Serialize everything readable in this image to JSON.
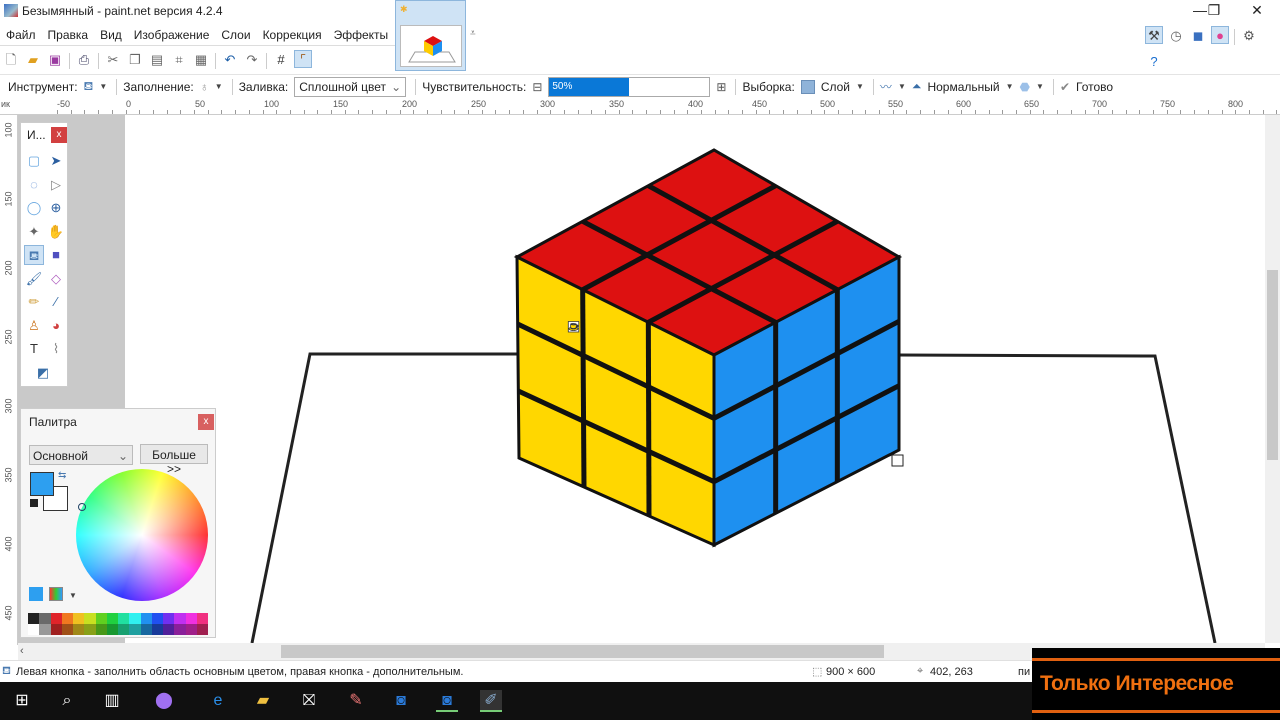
{
  "window": {
    "title": "Безымянный - paint.net версия 4.2.4",
    "minimize": "—",
    "restore": "❐",
    "close": "✕"
  },
  "menu": [
    "Файл",
    "Правка",
    "Вид",
    "Изображение",
    "Слои",
    "Коррекция",
    "Эффекты"
  ],
  "toolbar2": {
    "tool_label": "Инструмент:",
    "fill_mode_label": "Заполнение:",
    "fill_label": "Заливка:",
    "fill_value": "Сплошной цвет",
    "sensitivity_label": "Чувствительность:",
    "sensitivity_value": "50%",
    "sensitivity_percent": 50,
    "sampling_label": "Выборка:",
    "sampling_value": "Слой",
    "blend_value": "Нормальный",
    "done_label": "Готово"
  },
  "ruler_h": [
    "ик",
    "-50",
    "0",
    "50",
    "100",
    "150",
    "200",
    "250",
    "300",
    "350",
    "400",
    "450",
    "500",
    "550",
    "600",
    "650",
    "700",
    "750",
    "800"
  ],
  "ruler_v": [
    "100",
    "150",
    "200",
    "250",
    "300",
    "350",
    "400",
    "450"
  ],
  "tools_window": {
    "title": "И...",
    "close": "x"
  },
  "palette": {
    "title": "Палитра",
    "close": "x",
    "mode": "Основной",
    "more": "Больше >>",
    "primary": "#2d9ff0",
    "secondary": "#ffffff",
    "swatches_top": [
      "#222222",
      "#6a6a6a",
      "#e0242a",
      "#f07820",
      "#f0c020",
      "#c8e020",
      "#60d020",
      "#20d040",
      "#20e0a0",
      "#30f0f0",
      "#2090f0",
      "#2050f0",
      "#7030f0",
      "#c030f0",
      "#f030e0",
      "#f03080"
    ],
    "swatches_bottom": [
      "#ffffff",
      "#999999",
      "#a02020",
      "#a05018",
      "#a08818",
      "#88a018",
      "#489818",
      "#189830",
      "#18a070",
      "#20a0a0",
      "#1868a0",
      "#183a9a",
      "#50209a",
      "#8a209a",
      "#a0208a",
      "#a02050"
    ]
  },
  "cube": {
    "top_color": "#dd1111",
    "left_color": "#ffd700",
    "right_color": "#1e90f0",
    "line_color": "#111111"
  },
  "status": {
    "hint": "Левая кнопка - заполнить область основным цветом, правая кнопка - дополнительным.",
    "image_size": "900 × 600",
    "cursor_pos": "402, 263",
    "unit": "пи"
  },
  "overlay": {
    "text": "Только Интересное"
  }
}
